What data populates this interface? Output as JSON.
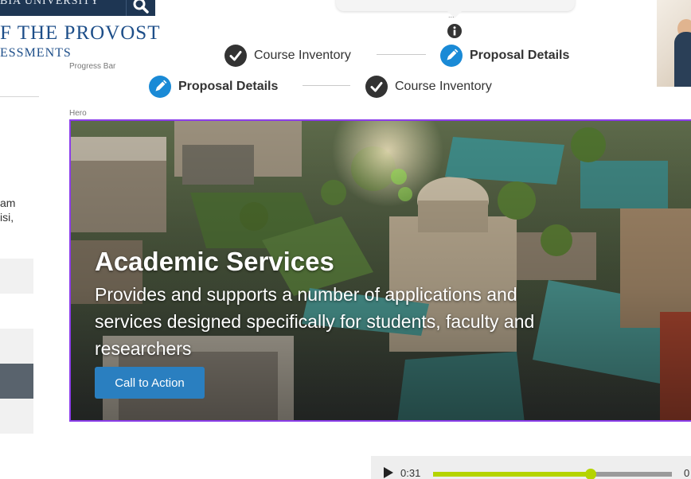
{
  "header": {
    "university": "BIA UNIVERSITY",
    "office_title": "F THE PROVOST",
    "office_subtitle": "ESSMENTS"
  },
  "labels": {
    "progress_bar": "Progress Bar",
    "hero": "Hero"
  },
  "tooltip": {
    "ellipsis": "..."
  },
  "progress_top": {
    "steps": [
      {
        "label": "Course Inventory",
        "state": "complete"
      },
      {
        "label": "Proposal Details",
        "state": "active"
      }
    ]
  },
  "progress_bottom": {
    "steps": [
      {
        "label": "Proposal Details",
        "state": "active"
      },
      {
        "label": "Course Inventory",
        "state": "complete"
      }
    ]
  },
  "left": {
    "text_line1": "am",
    "text_line2": "isi,"
  },
  "hero": {
    "title": "Academic Services",
    "description": "Provides and supports a number of applications and services designed specifically for students, faculty and researchers",
    "cta_label": "Call to Action"
  },
  "player": {
    "current_time": "0:31",
    "end_time": "0",
    "progress": 0.66
  },
  "colors": {
    "brand_navy": "#1e3653",
    "brand_blue": "#1d4e89",
    "step_active": "#1a8ad6",
    "step_complete": "#333333",
    "hero_outline": "#8b3dea",
    "cta": "#2a7fc0",
    "player_fill": "#b5d400"
  },
  "icons": {
    "search": "search-icon",
    "info": "info-icon",
    "check": "checkmark-icon",
    "edit": "pencil-icon",
    "play": "play-icon"
  }
}
